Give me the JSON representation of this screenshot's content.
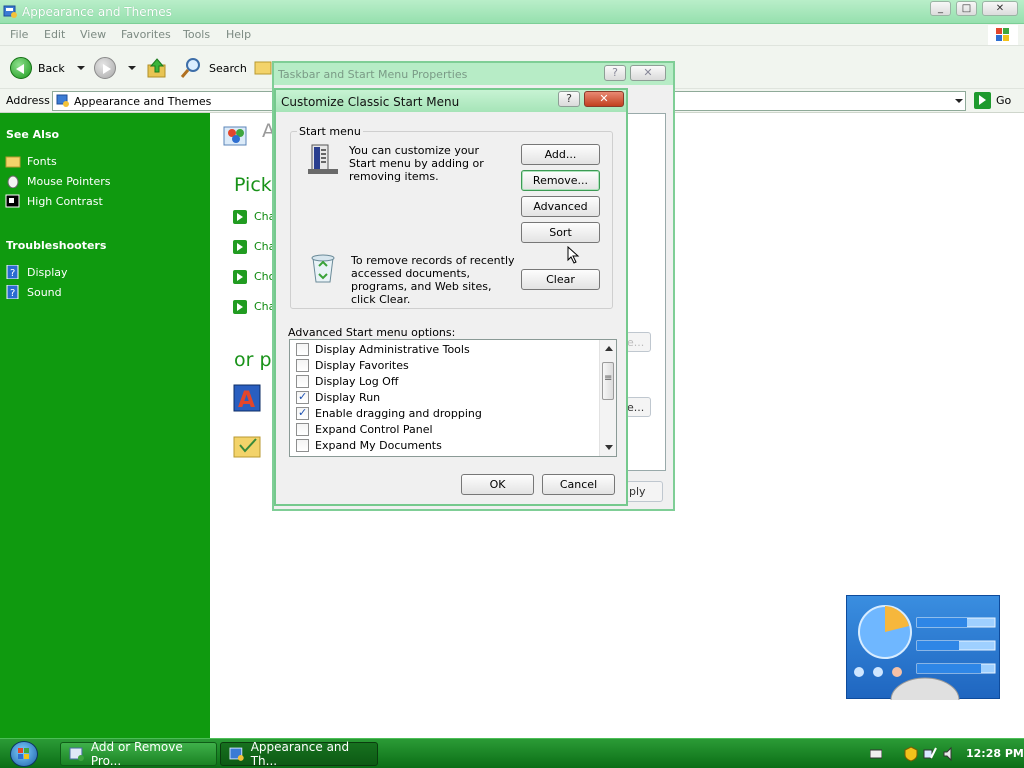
{
  "window": {
    "title": "Appearance and Themes",
    "controls": [
      "_",
      "□",
      "✕"
    ]
  },
  "menu": {
    "items": [
      "File",
      "Edit",
      "View",
      "Favorites",
      "Tools",
      "Help"
    ]
  },
  "toolbar": {
    "back_label": "Back",
    "search_label": "Search"
  },
  "address": {
    "label": "Address",
    "value": "Appearance and Themes",
    "go_label": "Go"
  },
  "sidebar": {
    "see_also": {
      "heading": "See Also",
      "items": [
        "Fonts",
        "Mouse Pointers",
        "High Contrast"
      ]
    },
    "troubleshooters": {
      "heading": "Troubleshooters",
      "items": [
        "Display",
        "Sound"
      ]
    }
  },
  "content": {
    "title_partial": "A",
    "pick_task": "Pick",
    "task_stubs": [
      "Cha",
      "Cha",
      "Cho",
      "Cha"
    ],
    "or_pick": "or pi"
  },
  "taskbar_dialog": {
    "title": "Taskbar and Start Menu Properties",
    "apply_partial": "ply",
    "ghost_partial_1": "e...",
    "ghost_partial_2": "e..."
  },
  "customize_dialog": {
    "title": "Customize Classic Start Menu",
    "help_glyph": "?",
    "close_glyph": "✕",
    "start_menu_group": "Start menu",
    "customize_text": "You can customize your Start menu by adding or removing items.",
    "clear_text": "To remove records of recently accessed documents, programs, and Web sites, click Clear.",
    "buttons": {
      "add": "Add...",
      "remove": "Remove...",
      "advanced": "Advanced",
      "sort": "Sort",
      "clear": "Clear",
      "ok": "OK",
      "cancel": "Cancel"
    },
    "advanced_label": "Advanced Start menu options:",
    "options": [
      {
        "label": "Display Administrative Tools",
        "checked": false
      },
      {
        "label": "Display Favorites",
        "checked": false
      },
      {
        "label": "Display Log Off",
        "checked": false
      },
      {
        "label": "Display Run",
        "checked": true
      },
      {
        "label": "Enable dragging and dropping",
        "checked": true
      },
      {
        "label": "Expand Control Panel",
        "checked": false
      },
      {
        "label": "Expand My Documents",
        "checked": false
      }
    ]
  },
  "taskbar": {
    "buttons": [
      {
        "label": "Add or Remove Pro...",
        "active": false
      },
      {
        "label": "Appearance and Th...",
        "active": true
      }
    ],
    "clock": "12:28 PM"
  },
  "colors": {
    "sidebar_green": "#0f9a0f",
    "title_green": "#b9eec9",
    "taskbar_green": "#1a8323",
    "accent_text_green": "#199219"
  }
}
